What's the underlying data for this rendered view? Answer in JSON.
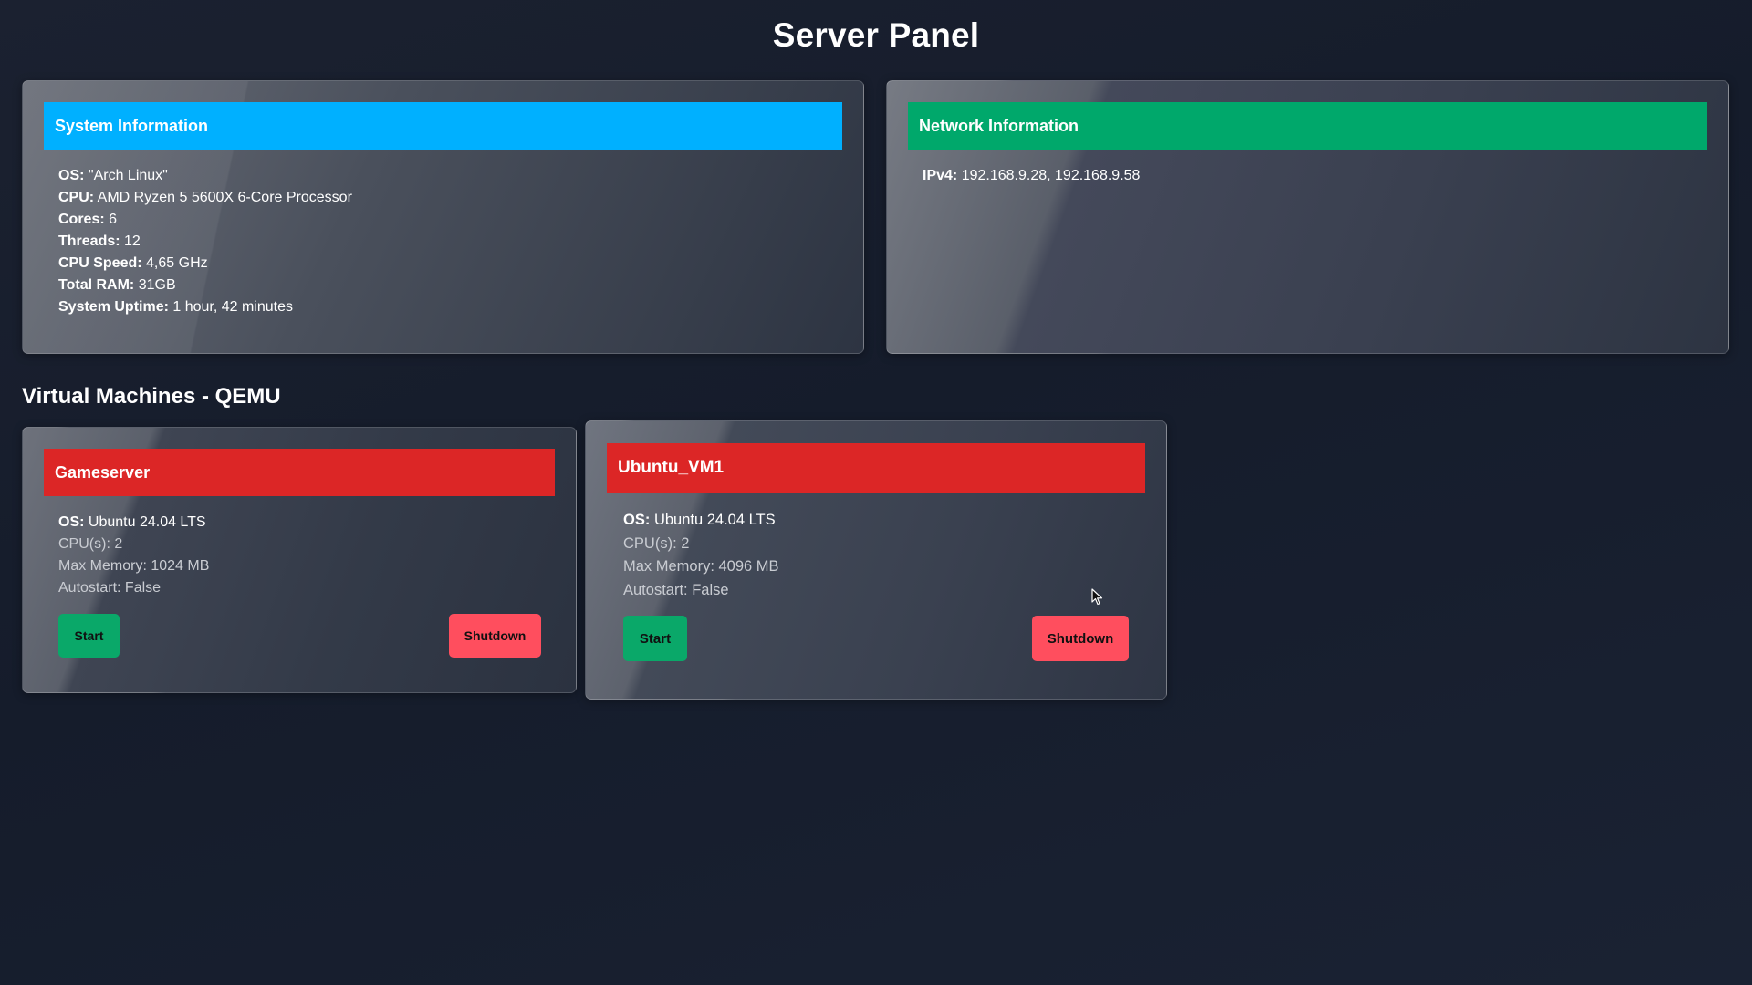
{
  "page": {
    "title": "Server Panel"
  },
  "system": {
    "header": "System Information",
    "header_color": "#00b0ff",
    "rows": [
      {
        "key": "OS:",
        "value": "\"Arch Linux\""
      },
      {
        "key": "CPU:",
        "value": "AMD Ryzen 5 5600X 6-Core Processor"
      },
      {
        "key": "Cores:",
        "value": "6"
      },
      {
        "key": "Threads:",
        "value": "12"
      },
      {
        "key": "CPU Speed:",
        "value": "4,65 GHz"
      },
      {
        "key": "Total RAM:",
        "value": "31GB"
      },
      {
        "key": "System Uptime:",
        "value": "1 hour, 42 minutes"
      }
    ]
  },
  "network": {
    "header": "Network Information",
    "header_color": "#00a86b",
    "rows": [
      {
        "key": "IPv4:",
        "value": "192.168.9.28, 192.168.9.58"
      }
    ]
  },
  "vms": {
    "section_title": "Virtual Machines - QEMU",
    "items": [
      {
        "name": "Gameserver",
        "header_color": "#dc2626",
        "os_label": "OS:",
        "os_value": "Ubuntu 24.04 LTS",
        "cpus": "CPU(s): 2",
        "memory": "Max Memory: 1024 MB",
        "autostart": "Autostart: False",
        "start_label": "Start",
        "shutdown_label": "Shutdown"
      },
      {
        "name": "Ubuntu_VM1",
        "header_color": "#dc2626",
        "os_label": "OS:",
        "os_value": "Ubuntu 24.04 LTS",
        "cpus": "CPU(s): 2",
        "memory": "Max Memory: 4096 MB",
        "autostart": "Autostart: False",
        "start_label": "Start",
        "shutdown_label": "Shutdown"
      }
    ]
  },
  "colors": {
    "start_button": "#0aa869",
    "shutdown_button": "#ff4e5e"
  },
  "icons": {
    "cursor": "mouse-pointer-icon"
  }
}
